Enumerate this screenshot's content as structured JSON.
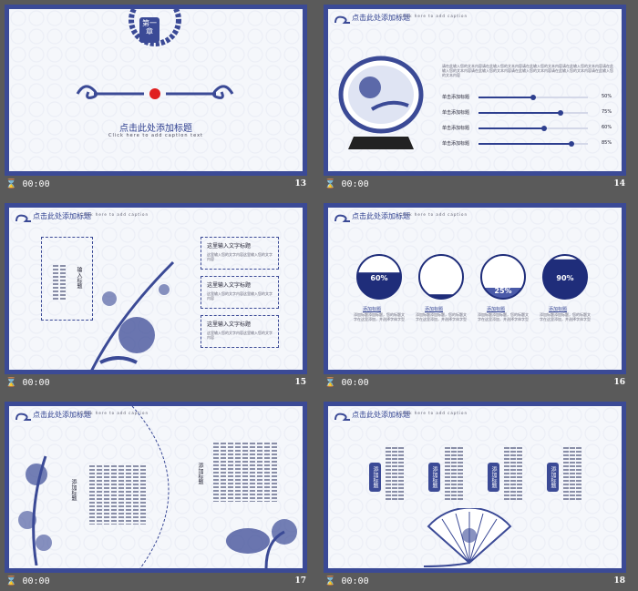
{
  "colors": {
    "accent": "#3b4a96",
    "bg": "#5a5a5a",
    "seal": "#e02020"
  },
  "slides": [
    {
      "footer_time": "00:00",
      "number": "13",
      "badge": "第一章",
      "title": "点击此处添加标题",
      "subtitle": "Click here to add caption text"
    },
    {
      "footer_time": "00:00",
      "number": "14",
      "title": "点击此处添加标题",
      "subtitle": "Click here to add caption",
      "paragraph": "请在此输入您的文本内容请在此输入您的文本内容请在此输入您的文本内容请在此输入您的文本内容请在此输入您的文本内容请在此输入您的文本内容请在此输入您的文本内容请在此输入您的文本内容请在此输入您的文本内容",
      "bars": [
        {
          "label": "单击添加标题",
          "value": 50,
          "pct": "50%"
        },
        {
          "label": "单击添加标题",
          "value": 75,
          "pct": "75%"
        },
        {
          "label": "单击添加标题",
          "value": 60,
          "pct": "60%"
        },
        {
          "label": "单击添加标题",
          "value": 85,
          "pct": "85%"
        }
      ]
    },
    {
      "footer_time": "00:00",
      "number": "15",
      "title": "点击此处添加标题",
      "subtitle": "Click here to add caption",
      "left_label": "输入标题",
      "boxes": [
        {
          "title": "这里输入文字标题",
          "text": "这里输入您的文字内容这里输入您的文字内容"
        },
        {
          "title": "这里输入文字标题",
          "text": "这里输入您的文字内容这里输入您的文字内容"
        },
        {
          "title": "这里输入文字标题",
          "text": "这里输入您的文字内容这里输入您的文字内容"
        }
      ]
    },
    {
      "footer_time": "00:00",
      "number": "16",
      "title": "点击此处添加标题",
      "subtitle": "Click here to add caption",
      "circles": [
        {
          "value": 0.6,
          "pct": "60%",
          "label": "添加标题",
          "text": "添加标题添加标题，您的标题文字在这里添加，并选择字体字型"
        },
        {
          "value": 0.1,
          "pct": "10%",
          "label": "添加标题",
          "text": "添加标题添加标题，您的标题文字在这里添加，并选择字体字型"
        },
        {
          "value": 0.25,
          "pct": "25%",
          "label": "添加标题",
          "text": "添加标题添加标题，您的标题文字在这里添加，并选择字体字型"
        },
        {
          "value": 0.9,
          "pct": "90%",
          "label": "添加标题",
          "text": "添加标题添加标题，您的标题文字在这里添加，并选择字体字型"
        }
      ]
    },
    {
      "footer_time": "00:00",
      "number": "17",
      "title": "点击此处添加标题",
      "subtitle": "Click here to add caption",
      "tag_a": "添加标题",
      "tag_b": "添加标题"
    },
    {
      "footer_time": "00:00",
      "number": "18",
      "title": "点击此处添加标题",
      "subtitle": "Click here to add caption",
      "tags": [
        "添加标题",
        "添加标题",
        "添加标题",
        "添加标题"
      ]
    }
  ]
}
